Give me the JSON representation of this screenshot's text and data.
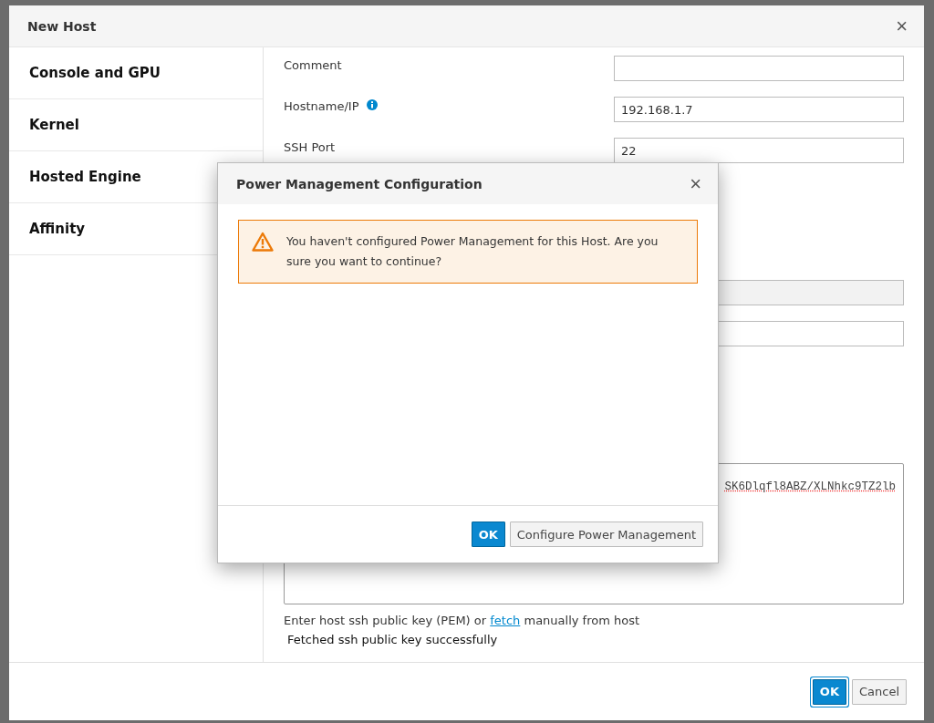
{
  "dialog": {
    "title": "New Host",
    "close": "×"
  },
  "sidebar": {
    "items": [
      {
        "label": "Console and GPU"
      },
      {
        "label": "Kernel"
      },
      {
        "label": "Hosted Engine"
      },
      {
        "label": "Affinity"
      }
    ]
  },
  "form": {
    "fields": [
      {
        "label": "Comment",
        "info": false
      },
      {
        "label": "Hostname/IP",
        "value": "192.168.1.7",
        "info": true
      },
      {
        "label": "SSH Port",
        "value": "22",
        "info": false
      }
    ],
    "hidden_fields": [
      {
        "disabled": true
      },
      {
        "disabled": false
      }
    ],
    "key_field": {
      "value": "SK6Dlqfl8ABZ/XLNhkc9TZ2lb"
    },
    "help": {
      "before": "Enter host ssh public key (PEM) or",
      "link": "fetch",
      "after": "manually from host"
    },
    "status": "Fetched ssh public key successfully"
  },
  "footer": {
    "buttons": [
      {
        "label": "OK",
        "primary": true
      },
      {
        "label": "Cancel",
        "primary": false
      }
    ]
  },
  "popup": {
    "title": "Power Management Configuration",
    "close": "×",
    "warning": "You haven't configured Power Management for this Host. Are you sure you want to continue?",
    "buttons": [
      {
        "label": "OK",
        "primary": true
      },
      {
        "label": "Configure Power Management",
        "primary": false
      }
    ]
  }
}
